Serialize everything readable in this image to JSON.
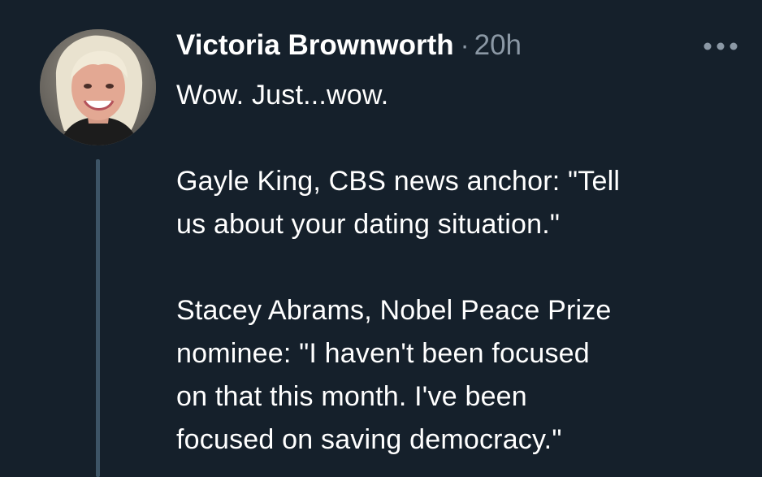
{
  "tweet": {
    "author": {
      "display_name": "Victoria Brownworth",
      "avatar_icon": "profile-photo"
    },
    "separator": "·",
    "timestamp": "20h",
    "more_icon": "more-horizontal-icon",
    "paragraphs": [
      [
        "Wow. Just...wow."
      ],
      [
        "Gayle King, CBS news anchor: \"Tell",
        "us about your dating situation.\""
      ],
      [
        "Stacey Abrams, Nobel Peace Prize",
        "nominee: \"I haven't been focused",
        "on that this month. I've been",
        "focused on saving democracy.\""
      ]
    ]
  },
  "colors": {
    "background": "#15202b",
    "text_primary": "#ffffff",
    "text_secondary": "#8b98a5",
    "thread_line": "#3d5466"
  }
}
